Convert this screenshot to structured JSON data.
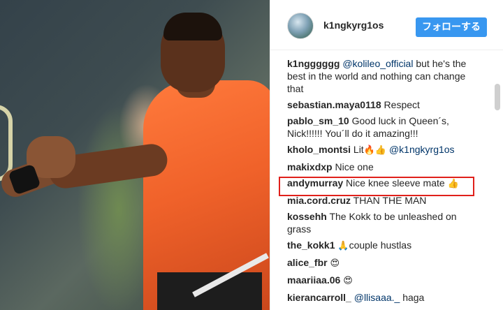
{
  "header": {
    "username": "k1ngkyrg1os",
    "follow_label": "フォローする"
  },
  "comments": [
    {
      "user": "k1ngggggg",
      "mention": "@kolileo_official",
      "text": " but he's the best in the world and nothing can change that"
    },
    {
      "user": "sebastian.maya0118",
      "text": " Respect"
    },
    {
      "user": "pablo_sm_10",
      "text": " Good luck in Queen´s, Nick!!!!!! You´ll do it amazing!!!"
    },
    {
      "user": "kholo_montsi",
      "text": " Lit",
      "emoji": "🔥👍",
      "mention": "@k1ngkyrg1os"
    },
    {
      "user": "makixdxp",
      "text": " Nice one"
    },
    {
      "user": "andymurray",
      "text": " Nice knee sleeve mate ",
      "emoji": "👍"
    },
    {
      "user": "mia.cord.cruz",
      "text": " THAN THE MAN"
    },
    {
      "user": "kossehh",
      "text": " The Kokk to be unleashed on grass"
    },
    {
      "user": "the_kokk1",
      "emoji": "🙏",
      "text": "couple hustlas"
    },
    {
      "user": "alice_fbr",
      "emoji": "😍"
    },
    {
      "user": "maariiaa.06",
      "emoji": "😍"
    },
    {
      "user": "kierancarroll_",
      "mention": "@llisaaa._",
      "text": " haga"
    }
  ],
  "icons": {
    "avatar": "profile-photo",
    "photo": "tennis-handshake-photo"
  },
  "colors": {
    "follow_bg": "#3897f0",
    "highlight_border": "#e0201b",
    "mention": "#003569"
  }
}
